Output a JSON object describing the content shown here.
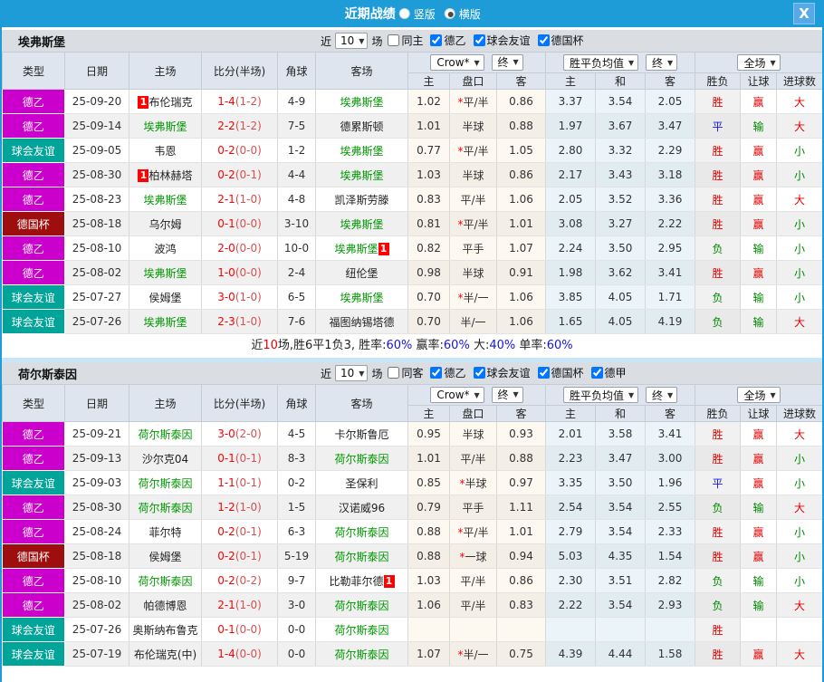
{
  "titlebar": {
    "title": "近期战绩",
    "radio_vertical": "竖版",
    "radio_horizontal": "横版",
    "close": "X"
  },
  "filters": {
    "near": "近",
    "count": "10",
    "matches": "场",
    "crow": "Crow*",
    "final1": "终",
    "avg": "胜平负均值",
    "final2": "终",
    "fullmatch": "全场"
  },
  "columns": {
    "type": "类型",
    "date": "日期",
    "home": "主场",
    "score": "比分(半场)",
    "corner": "角球",
    "away": "客场",
    "odds_home": "主",
    "handicap": "盘口",
    "odds_away": "客",
    "avg_home": "主",
    "avg_draw": "和",
    "avg_away": "客",
    "res_wdl": "胜负",
    "res_let": "让球",
    "res_goal": "进球数"
  },
  "colors": {
    "accent": "#1E9CD8",
    "leagues": {
      "德乙": "#CC00CC",
      "球会友谊": "#00A498",
      "德国杯": "#9E0E0E",
      "德甲": "#CC00CC"
    },
    "team_green": "#009900",
    "result_text": {
      "胜": "#E60000",
      "平": "#1414E6",
      "负": "#008800",
      "赢": "#E60000",
      "输": "#008800",
      "大": "#E60000",
      "小": "#008800"
    }
  },
  "sections": [
    {
      "team": "埃弗斯堡",
      "checkboxes": [
        {
          "label": "同主",
          "checked": false
        },
        {
          "label": "德乙",
          "checked": true
        },
        {
          "label": "球会友谊",
          "checked": true
        },
        {
          "label": "德国杯",
          "checked": true
        }
      ],
      "rows": [
        {
          "league": "德乙",
          "date": "25-09-20",
          "home": {
            "name": "布伦瑞克",
            "green": false,
            "badge": "1",
            "badge_pos": "before"
          },
          "score": "1-4",
          "half": "(1-2)",
          "corner": "4-9",
          "away": {
            "name": "埃弗斯堡",
            "green": true
          },
          "odds_home": "1.02",
          "handicap": "*平/半",
          "odds_away": "0.86",
          "avg_home": "3.37",
          "avg_draw": "3.54",
          "avg_away": "2.05",
          "res_wdl": "胜",
          "res_let": "赢",
          "res_goal": "大"
        },
        {
          "league": "德乙",
          "date": "25-09-14",
          "home": {
            "name": "埃弗斯堡",
            "green": true
          },
          "score": "2-2",
          "half": "(1-2)",
          "corner": "7-5",
          "away": {
            "name": "德累斯顿",
            "green": false
          },
          "odds_home": "1.01",
          "handicap": "半球",
          "odds_away": "0.88",
          "avg_home": "1.97",
          "avg_draw": "3.67",
          "avg_away": "3.47",
          "res_wdl": "平",
          "res_let": "输",
          "res_goal": "大"
        },
        {
          "league": "球会友谊",
          "date": "25-09-05",
          "home": {
            "name": "韦恩",
            "green": false
          },
          "score": "0-2",
          "half": "(0-0)",
          "corner": "1-2",
          "away": {
            "name": "埃弗斯堡",
            "green": true
          },
          "odds_home": "0.77",
          "handicap": "*平/半",
          "odds_away": "1.05",
          "avg_home": "2.80",
          "avg_draw": "3.32",
          "avg_away": "2.29",
          "res_wdl": "胜",
          "res_let": "赢",
          "res_goal": "小"
        },
        {
          "league": "德乙",
          "date": "25-08-30",
          "home": {
            "name": "柏林赫塔",
            "green": false,
            "badge": "1",
            "badge_pos": "before"
          },
          "score": "0-2",
          "half": "(0-1)",
          "corner": "4-4",
          "away": {
            "name": "埃弗斯堡",
            "green": true
          },
          "odds_home": "1.03",
          "handicap": "半球",
          "odds_away": "0.86",
          "avg_home": "2.17",
          "avg_draw": "3.43",
          "avg_away": "3.18",
          "res_wdl": "胜",
          "res_let": "赢",
          "res_goal": "小"
        },
        {
          "league": "德乙",
          "date": "25-08-23",
          "home": {
            "name": "埃弗斯堡",
            "green": true
          },
          "score": "2-1",
          "half": "(1-0)",
          "corner": "4-8",
          "away": {
            "name": "凯泽斯劳滕",
            "green": false
          },
          "odds_home": "0.83",
          "handicap": "平/半",
          "odds_away": "1.06",
          "avg_home": "2.05",
          "avg_draw": "3.52",
          "avg_away": "3.36",
          "res_wdl": "胜",
          "res_let": "赢",
          "res_goal": "大"
        },
        {
          "league": "德国杯",
          "date": "25-08-18",
          "home": {
            "name": "乌尔姆",
            "green": false
          },
          "score": "0-1",
          "half": "(0-0)",
          "corner": "3-10",
          "away": {
            "name": "埃弗斯堡",
            "green": true
          },
          "odds_home": "0.81",
          "handicap": "*平/半",
          "odds_away": "1.01",
          "avg_home": "3.08",
          "avg_draw": "3.27",
          "avg_away": "2.22",
          "res_wdl": "胜",
          "res_let": "赢",
          "res_goal": "小"
        },
        {
          "league": "德乙",
          "date": "25-08-10",
          "home": {
            "name": "波鸿",
            "green": false
          },
          "score": "2-0",
          "half": "(0-0)",
          "corner": "10-0",
          "away": {
            "name": "埃弗斯堡",
            "green": true,
            "badge": "1",
            "badge_pos": "after"
          },
          "odds_home": "0.82",
          "handicap": "平手",
          "odds_away": "1.07",
          "avg_home": "2.24",
          "avg_draw": "3.50",
          "avg_away": "2.95",
          "res_wdl": "负",
          "res_let": "输",
          "res_goal": "小"
        },
        {
          "league": "德乙",
          "date": "25-08-02",
          "home": {
            "name": "埃弗斯堡",
            "green": true
          },
          "score": "1-0",
          "half": "(0-0)",
          "corner": "2-4",
          "away": {
            "name": "纽伦堡",
            "green": false
          },
          "odds_home": "0.98",
          "handicap": "半球",
          "odds_away": "0.91",
          "avg_home": "1.98",
          "avg_draw": "3.62",
          "avg_away": "3.41",
          "res_wdl": "胜",
          "res_let": "赢",
          "res_goal": "小"
        },
        {
          "league": "球会友谊",
          "date": "25-07-27",
          "home": {
            "name": "侯姆堡",
            "green": false
          },
          "score": "3-0",
          "half": "(1-0)",
          "corner": "6-5",
          "away": {
            "name": "埃弗斯堡",
            "green": true
          },
          "odds_home": "0.70",
          "handicap": "*半/一",
          "odds_away": "1.06",
          "avg_home": "3.85",
          "avg_draw": "4.05",
          "avg_away": "1.71",
          "res_wdl": "负",
          "res_let": "输",
          "res_goal": "小"
        },
        {
          "league": "球会友谊",
          "date": "25-07-26",
          "home": {
            "name": "埃弗斯堡",
            "green": true
          },
          "score": "2-3",
          "half": "(1-0)",
          "corner": "7-6",
          "away": {
            "name": "福图纳锡塔德",
            "green": false
          },
          "odds_home": "0.70",
          "handicap": "半/一",
          "odds_away": "1.06",
          "avg_home": "1.65",
          "avg_draw": "4.05",
          "avg_away": "4.19",
          "res_wdl": "负",
          "res_let": "输",
          "res_goal": "大"
        }
      ],
      "summary": [
        {
          "t": "近",
          "c": "k"
        },
        {
          "t": "10",
          "c": "r"
        },
        {
          "t": "场,胜6平1负3, 胜率:",
          "c": "k"
        },
        {
          "t": "60%",
          "c": "b"
        },
        {
          "t": " 赢率:",
          "c": "k"
        },
        {
          "t": "60%",
          "c": "b"
        },
        {
          "t": " 大:",
          "c": "k"
        },
        {
          "t": "40%",
          "c": "b"
        },
        {
          "t": " 单率:",
          "c": "k"
        },
        {
          "t": "60%",
          "c": "b"
        }
      ]
    },
    {
      "team": "荷尔斯泰因",
      "checkboxes": [
        {
          "label": "同客",
          "checked": false
        },
        {
          "label": "德乙",
          "checked": true
        },
        {
          "label": "球会友谊",
          "checked": true
        },
        {
          "label": "德国杯",
          "checked": true
        },
        {
          "label": "德甲",
          "checked": true
        }
      ],
      "rows": [
        {
          "league": "德乙",
          "date": "25-09-21",
          "home": {
            "name": "荷尔斯泰因",
            "green": true
          },
          "score": "3-0",
          "half": "(2-0)",
          "corner": "4-5",
          "away": {
            "name": "卡尔斯鲁厄",
            "green": false
          },
          "odds_home": "0.95",
          "handicap": "半球",
          "odds_away": "0.93",
          "avg_home": "2.01",
          "avg_draw": "3.58",
          "avg_away": "3.41",
          "res_wdl": "胜",
          "res_let": "赢",
          "res_goal": "大"
        },
        {
          "league": "德乙",
          "date": "25-09-13",
          "home": {
            "name": "沙尔克04",
            "green": false
          },
          "score": "0-1",
          "half": "(0-1)",
          "corner": "8-3",
          "away": {
            "name": "荷尔斯泰因",
            "green": true
          },
          "odds_home": "1.01",
          "handicap": "平/半",
          "odds_away": "0.88",
          "avg_home": "2.23",
          "avg_draw": "3.47",
          "avg_away": "3.00",
          "res_wdl": "胜",
          "res_let": "赢",
          "res_goal": "小"
        },
        {
          "league": "球会友谊",
          "date": "25-09-03",
          "home": {
            "name": "荷尔斯泰因",
            "green": true
          },
          "score": "1-1",
          "half": "(0-1)",
          "corner": "0-2",
          "away": {
            "name": "圣保利",
            "green": false
          },
          "odds_home": "0.85",
          "handicap": "*半球",
          "odds_away": "0.97",
          "avg_home": "3.35",
          "avg_draw": "3.50",
          "avg_away": "1.96",
          "res_wdl": "平",
          "res_let": "赢",
          "res_goal": "小"
        },
        {
          "league": "德乙",
          "date": "25-08-30",
          "home": {
            "name": "荷尔斯泰因",
            "green": true
          },
          "score": "1-2",
          "half": "(1-0)",
          "corner": "1-5",
          "away": {
            "name": "汉诺威96",
            "green": false
          },
          "odds_home": "0.79",
          "handicap": "平手",
          "odds_away": "1.11",
          "avg_home": "2.54",
          "avg_draw": "3.54",
          "avg_away": "2.55",
          "res_wdl": "负",
          "res_let": "输",
          "res_goal": "大"
        },
        {
          "league": "德乙",
          "date": "25-08-24",
          "home": {
            "name": "菲尔特",
            "green": false
          },
          "score": "0-2",
          "half": "(0-1)",
          "corner": "6-3",
          "away": {
            "name": "荷尔斯泰因",
            "green": true
          },
          "odds_home": "0.88",
          "handicap": "*平/半",
          "odds_away": "1.01",
          "avg_home": "2.79",
          "avg_draw": "3.54",
          "avg_away": "2.33",
          "res_wdl": "胜",
          "res_let": "赢",
          "res_goal": "小"
        },
        {
          "league": "德国杯",
          "date": "25-08-18",
          "home": {
            "name": "侯姆堡",
            "green": false
          },
          "score": "0-2",
          "half": "(0-1)",
          "corner": "5-19",
          "away": {
            "name": "荷尔斯泰因",
            "green": true
          },
          "odds_home": "0.88",
          "handicap": "*一球",
          "odds_away": "0.94",
          "avg_home": "5.03",
          "avg_draw": "4.35",
          "avg_away": "1.54",
          "res_wdl": "胜",
          "res_let": "赢",
          "res_goal": "小"
        },
        {
          "league": "德乙",
          "date": "25-08-10",
          "home": {
            "name": "荷尔斯泰因",
            "green": true
          },
          "score": "0-2",
          "half": "(0-2)",
          "corner": "9-7",
          "away": {
            "name": "比勒菲尔德",
            "green": false,
            "badge": "1",
            "badge_pos": "after"
          },
          "odds_home": "1.03",
          "handicap": "平/半",
          "odds_away": "0.86",
          "avg_home": "2.30",
          "avg_draw": "3.51",
          "avg_away": "2.82",
          "res_wdl": "负",
          "res_let": "输",
          "res_goal": "小"
        },
        {
          "league": "德乙",
          "date": "25-08-02",
          "home": {
            "name": "帕德博恩",
            "green": false
          },
          "score": "2-1",
          "half": "(1-0)",
          "corner": "3-0",
          "away": {
            "name": "荷尔斯泰因",
            "green": true
          },
          "odds_home": "1.06",
          "handicap": "平/半",
          "odds_away": "0.83",
          "avg_home": "2.22",
          "avg_draw": "3.54",
          "avg_away": "2.93",
          "res_wdl": "负",
          "res_let": "输",
          "res_goal": "大"
        },
        {
          "league": "球会友谊",
          "date": "25-07-26",
          "home": {
            "name": "奥斯纳布鲁克",
            "green": false
          },
          "score": "0-1",
          "half": "(0-0)",
          "corner": "0-0",
          "away": {
            "name": "荷尔斯泰因",
            "green": true
          },
          "odds_home": "",
          "handicap": "",
          "odds_away": "",
          "avg_home": "",
          "avg_draw": "",
          "avg_away": "",
          "res_wdl": "胜",
          "res_let": "",
          "res_goal": ""
        },
        {
          "league": "球会友谊",
          "date": "25-07-19",
          "home": {
            "name": "布伦瑞克(中)",
            "green": false
          },
          "score": "1-4",
          "half": "(0-0)",
          "corner": "0-0",
          "away": {
            "name": "荷尔斯泰因",
            "green": true
          },
          "odds_home": "1.07",
          "handicap": "*半/一",
          "odds_away": "0.75",
          "avg_home": "4.39",
          "avg_draw": "4.44",
          "avg_away": "1.58",
          "res_wdl": "胜",
          "res_let": "赢",
          "res_goal": "大"
        }
      ],
      "summary": null
    }
  ]
}
